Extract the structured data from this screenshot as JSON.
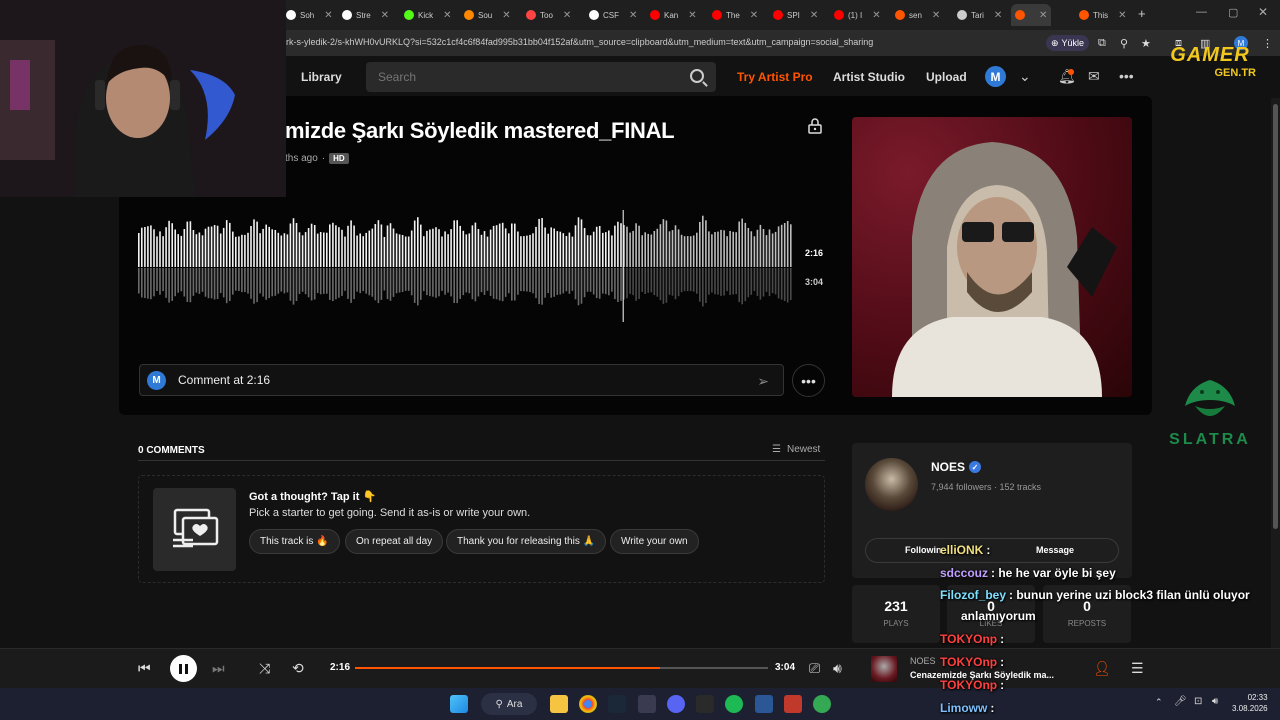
{
  "browser": {
    "tabs": [
      {
        "label": "Soh",
        "color": "#ffffff"
      },
      {
        "label": "Stre",
        "color": "#ffffff"
      },
      {
        "label": "Kick",
        "color": "#53fc18"
      },
      {
        "label": "Sou",
        "color": "#ff8800"
      },
      {
        "label": "Too",
        "color": "#ff4444"
      },
      {
        "label": "CSF",
        "color": "#ffffff"
      },
      {
        "label": "Kan",
        "color": "#ff0000"
      },
      {
        "label": "The",
        "color": "#ff0000"
      },
      {
        "label": "SPI",
        "color": "#ff0000"
      },
      {
        "label": "(1) I",
        "color": "#ff0000"
      },
      {
        "label": "sen",
        "color": "#ff5500"
      },
      {
        "label": "Tari",
        "color": "#cccccc"
      },
      {
        "label": "",
        "color": "#ff5500"
      },
      {
        "label": "This",
        "color": "#ff5500"
      }
    ],
    "url": "rk-s-yledik-2/s-khWH0vURKLQ?si=532c1cf4c6f84fad995b31bb04f152af&utm_source=clipboard&utm_medium=text&utm_campaign=social_sharing",
    "yukle_label": "Yükle",
    "profile_initial": "M"
  },
  "header": {
    "library": "Library",
    "search_placeholder": "Search",
    "try_pro": "Try Artist Pro",
    "artist_studio": "Artist Studio",
    "upload": "Upload",
    "avatar_initial": "M"
  },
  "track": {
    "title": "mizde Şarkı Söyledik mastered_FINAL",
    "age": "ths ago",
    "hd": "HD",
    "current_time": "2:16",
    "total_time": "3:04",
    "progress_fraction": 0.739
  },
  "comment_input": {
    "avatar_initial": "M",
    "value": "Comment at 2:16"
  },
  "comments": {
    "count_label": "0 COMMENTS",
    "sort_label": "Newest",
    "prompt_heading": "Got a thought? Tap it 👇",
    "prompt_sub": "Pick a starter to get going. Send it as-is or write your own.",
    "chips": [
      "This track is 🔥",
      "On repeat all day",
      "Thank you for releasing this 🙏",
      "Write your own"
    ]
  },
  "artist": {
    "name": "NOES",
    "stats": "7,944 followers · 152 tracks",
    "follow_label": "Followin",
    "message_label": "Message",
    "plays_value": "231",
    "plays_label": "PLAYS",
    "likes_value": "0",
    "likes_label": "LIKES",
    "reposts_value": "0",
    "reposts_label": "REPOSTS"
  },
  "player": {
    "current": "2:16",
    "total": "3:04",
    "progress_fraction": 0.739,
    "artist": "NOES",
    "title": "Cenazemizde Şarkı Söyledik ma..."
  },
  "taskbar": {
    "search_label": "Ara",
    "time": "02:33",
    "date": "3.08.2026"
  },
  "overlay": {
    "brand_top": "GAMER",
    "brand_bottom": "GEN.TR",
    "sponsor": "SLATRA",
    "chat": [
      {
        "user": "elliONK",
        "text": ":",
        "user_color": "#f0e080"
      },
      {
        "user": "sdccouz",
        "text": ": he he var öyle bi şey",
        "user_color": "#c0a0ff"
      },
      {
        "user": "Filozof_bey",
        "text": ": bunun yerine uzi block3 filan ünlü oluyor",
        "user_color": "#7ee0ff"
      },
      {
        "user": "",
        "text": "anlamıyorum",
        "user_color": "#ffffff"
      },
      {
        "user": "TOKYOnp",
        "text": ":",
        "user_color": "#ff4040"
      },
      {
        "user": "TOKYOnp",
        "text": ":",
        "user_color": "#ff4040"
      },
      {
        "user": "TOKYOnp",
        "text": ":",
        "user_color": "#ff4040"
      },
      {
        "user": "Limoww",
        "text": ":",
        "user_color": "#7ec0ff"
      }
    ]
  }
}
